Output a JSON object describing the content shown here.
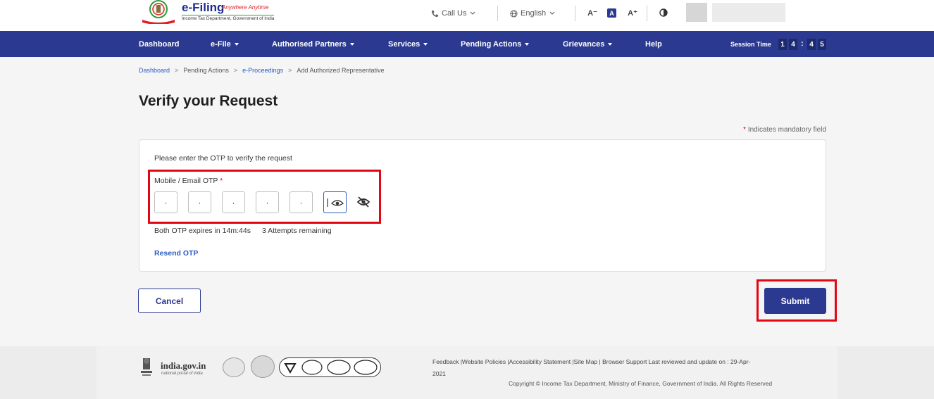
{
  "header": {
    "brand": "e-Filing",
    "tagline": "Anywhere Anytime",
    "department": "Income Tax Department, Government of India",
    "call_us": "Call Us",
    "language": "English",
    "font_decrease": "A⁻",
    "font_normal": "A",
    "font_increase": "A⁺"
  },
  "nav": {
    "items": [
      {
        "label": "Dashboard"
      },
      {
        "label": "e-File"
      },
      {
        "label": "Authorised Partners"
      },
      {
        "label": "Services"
      },
      {
        "label": "Pending Actions"
      },
      {
        "label": "Grievances"
      },
      {
        "label": "Help"
      }
    ],
    "session_label": "Session Time",
    "session_digits": [
      "1",
      "4",
      "4",
      "5"
    ],
    "session_separator": ":"
  },
  "breadcrumb": {
    "items": [
      "Dashboard",
      "Pending Actions",
      "e-Proceedings",
      "Add Authorized Representative"
    ],
    "separator": ">"
  },
  "page": {
    "title": "Verify your Request",
    "mandatory_star": "*",
    "mandatory_note": "Indicates mandatory field"
  },
  "form": {
    "prompt": "Please enter the OTP to verify the request",
    "otp_label": "Mobile / Email OTP",
    "otp_required": "*",
    "otp_values": [
      "·",
      "·",
      "·",
      "·",
      "·",
      ""
    ],
    "expiry_text": "Both OTP expires in 14m:44s",
    "attempts_text": "3 Attempts remaining",
    "resend_label": "Resend OTP"
  },
  "actions": {
    "cancel_label": "Cancel",
    "submit_label": "Submit"
  },
  "footer": {
    "gov_site": "india.gov.in",
    "gov_sub": "national portal of india",
    "links": "Feedback |Website Policies |Accessibility Statement |Site Map | Browser Support   Last reviewed and update on : 29-Apr-",
    "date_tail": "2021",
    "copyright": "Copyright © Income Tax Department, Ministry of Finance, Government of India. All Rights Reserved"
  },
  "colors": {
    "primary": "#2b3990",
    "highlight": "#e30613",
    "link": "#2b5bbf"
  }
}
